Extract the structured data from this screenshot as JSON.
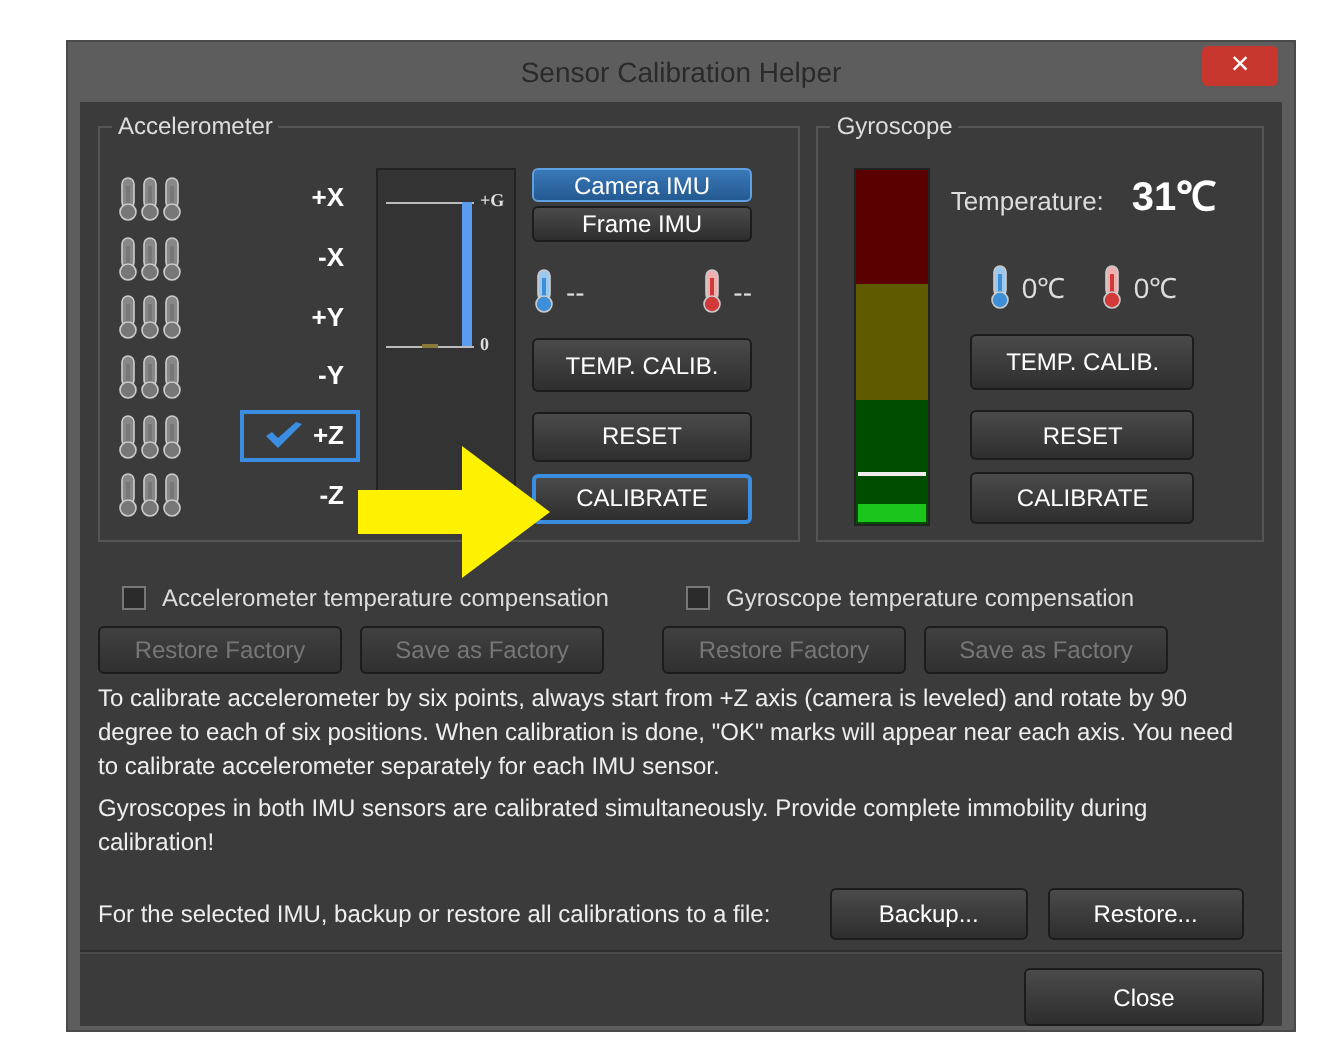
{
  "window": {
    "title": "Sensor Calibration Helper",
    "close_glyph": "×"
  },
  "accelerometer": {
    "title": "Accelerometer",
    "axes": [
      {
        "label": "+X",
        "selected": false,
        "calibrated": false
      },
      {
        "label": "-X",
        "selected": false,
        "calibrated": false
      },
      {
        "label": "+Y",
        "selected": false,
        "calibrated": false
      },
      {
        "label": "-Y",
        "selected": false,
        "calibrated": false
      },
      {
        "label": "+Z",
        "selected": true,
        "calibrated": true
      },
      {
        "label": "-Z",
        "selected": false,
        "calibrated": false
      }
    ],
    "meter": {
      "top_label": "+G",
      "zero_label": "0"
    },
    "imu_buttons": [
      {
        "label": "Camera IMU",
        "selected": true
      },
      {
        "label": "Frame IMU",
        "selected": false
      }
    ],
    "temps": [
      {
        "kind": "cold",
        "reading": "--"
      },
      {
        "kind": "hot",
        "reading": "--"
      }
    ],
    "buttons": [
      {
        "label": "TEMP. CALIB.",
        "focused": false
      },
      {
        "label": "RESET",
        "focused": false
      },
      {
        "label": "CALIBRATE",
        "focused": true
      }
    ]
  },
  "gyroscope": {
    "title": "Gyroscope",
    "meter": {
      "level": 0.05
    },
    "temperature_label": "Temperature:",
    "temperature": "31℃",
    "temps": [
      {
        "kind": "cold",
        "reading": "0℃"
      },
      {
        "kind": "hot",
        "reading": "0℃"
      }
    ],
    "buttons": [
      {
        "label": "TEMP. CALIB.",
        "focused": false
      },
      {
        "label": "RESET",
        "focused": false
      },
      {
        "label": "CALIBRATE",
        "focused": false
      }
    ]
  },
  "compensation": [
    {
      "label": "Accelerometer temperature compensation",
      "checked": false
    },
    {
      "label": "Gyroscope temperature compensation",
      "checked": false
    }
  ],
  "factory_buttons": [
    {
      "label": "Restore Factory",
      "disabled": true
    },
    {
      "label": "Save as Factory",
      "disabled": true
    },
    {
      "label": "Restore Factory",
      "disabled": true
    },
    {
      "label": "Save as Factory",
      "disabled": true
    }
  ],
  "instructions": [
    "To calibrate accelerometer by six points, always start from +Z axis (camera is leveled) and rotate by 90 degree to each of six positions. When calibration is done, \"OK\" marks will appear near each axis. You need to calibrate accelerometer separately for each IMU sensor.",
    "Gyroscopes in both IMU sensors are calibrated simultaneously. Provide complete immobility during calibration!"
  ],
  "backup": {
    "text": "For the selected IMU, backup or restore all calibrations to a file:",
    "buttons": [
      "Backup...",
      "Restore..."
    ]
  },
  "footer": {
    "close": "Close"
  }
}
